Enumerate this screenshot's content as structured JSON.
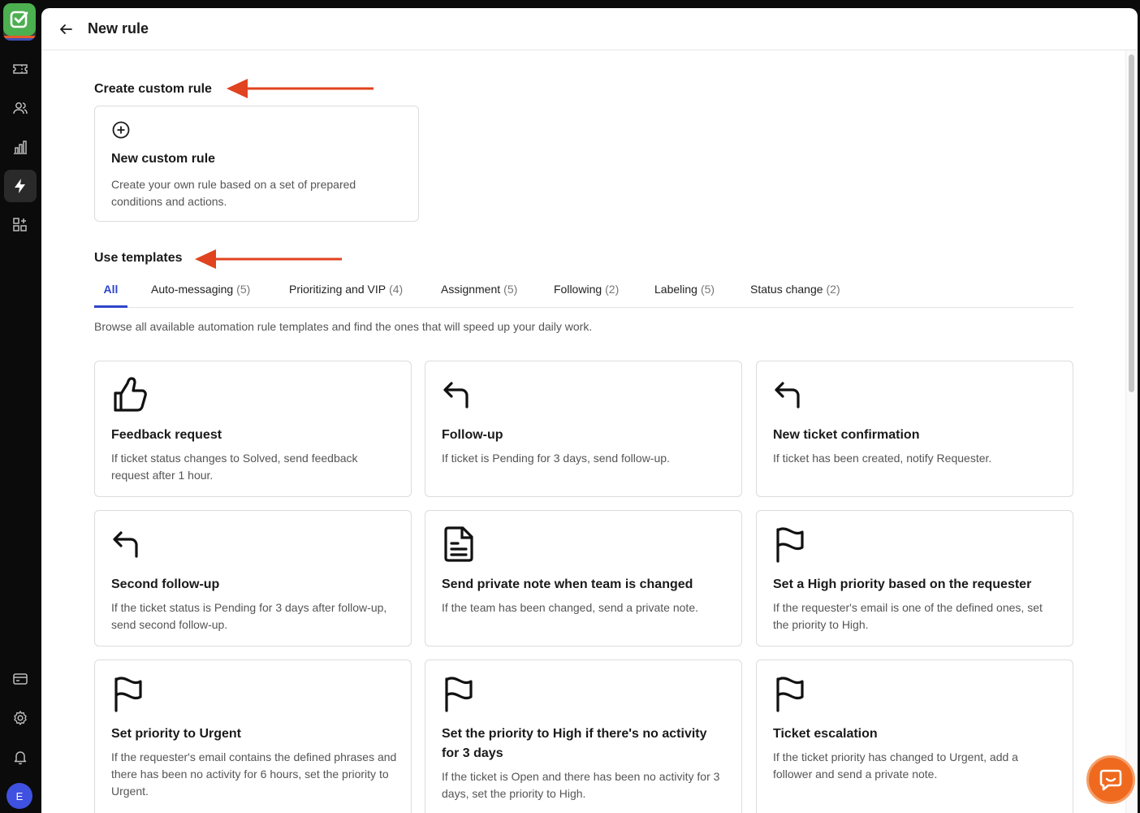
{
  "header": {
    "title": "New rule"
  },
  "rail": {
    "avatar_initial": "E"
  },
  "sections": {
    "custom_title": "Create custom rule",
    "templates_title": "Use templates"
  },
  "custom_card": {
    "title": "New custom rule",
    "description": "Create your own rule based on a set of prepared conditions and actions."
  },
  "tabs": [
    {
      "label": "All",
      "count": ""
    },
    {
      "label": "Auto-messaging",
      "count": "(5)"
    },
    {
      "label": "Prioritizing and VIP",
      "count": "(4)"
    },
    {
      "label": "Assignment",
      "count": "(5)"
    },
    {
      "label": "Following",
      "count": "(2)"
    },
    {
      "label": "Labeling",
      "count": "(5)"
    },
    {
      "label": "Status change",
      "count": "(2)"
    }
  ],
  "browse_text": "Browse all available automation rule templates and find the ones that will speed up your daily work.",
  "templates": [
    {
      "icon": "thumbs-up-icon",
      "title": "Feedback request",
      "description": "If ticket status changes to Solved, send feedback request after 1 hour."
    },
    {
      "icon": "reply-icon",
      "title": "Follow-up",
      "description": "If ticket is Pending for 3 days, send follow-up."
    },
    {
      "icon": "reply-icon",
      "title": "New ticket confirmation",
      "description": "If ticket has been created, notify Requester."
    },
    {
      "icon": "reply-icon",
      "title": "Second follow-up",
      "description": "If the ticket status is Pending for 3 days after follow-up, send second follow-up."
    },
    {
      "icon": "document-icon",
      "title": "Send private note when team is changed",
      "description": "If the team has been changed, send a private note."
    },
    {
      "icon": "flag-icon",
      "title": "Set a High priority based on the requester",
      "description": "If the requester's email is one of the defined ones, set the priority to High."
    },
    {
      "icon": "flag-icon",
      "title": "Set priority to Urgent",
      "description": "If the requester's email contains the defined phrases and there has been no activity for 6 hours, set the priority to Urgent."
    },
    {
      "icon": "flag-icon",
      "title": "Set the priority to High if there's no activity for 3 days",
      "description": "If the ticket is Open and there has been no activity for 3 days, set the priority to High."
    },
    {
      "icon": "flag-icon",
      "title": "Ticket escalation",
      "description": "If the ticket priority has changed to Urgent, add a follower and send a private note."
    }
  ],
  "colors": {
    "accent": "#2f46c9",
    "arrow": "#e0431f",
    "chat": "#ef6a1f"
  }
}
